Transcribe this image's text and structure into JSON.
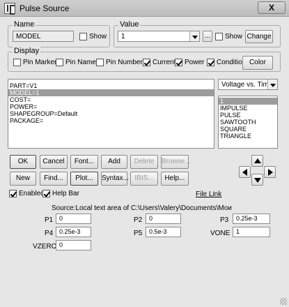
{
  "window": {
    "title": "Pulse Source",
    "close_label": "X"
  },
  "name_group": {
    "label": "Name",
    "value": "MODEL",
    "show_label": "Show",
    "show_checked": false
  },
  "value_group": {
    "label": "Value",
    "value": "1",
    "ellipsis_label": "...",
    "show_label": "Show",
    "show_checked": false,
    "change_label": "Change"
  },
  "display_group": {
    "label": "Display",
    "pin_markers": {
      "label": "Pin Markers",
      "checked": false
    },
    "pin_names": {
      "label": "Pin Names",
      "checked": false
    },
    "pin_numbers": {
      "label": "Pin Numbers",
      "checked": false
    },
    "current": {
      "label": "Current",
      "checked": true
    },
    "power": {
      "label": "Power",
      "checked": true
    },
    "condition": {
      "label": "Condition",
      "checked": true
    },
    "color_label": "Color"
  },
  "attributes": [
    "PART=V1",
    "MODEL=1",
    "COST=",
    "POWER=",
    "SHAPEGROUP=Default",
    "PACKAGE="
  ],
  "selected_attribute_index": 1,
  "plot_type": {
    "value": "Voltage vs. Time"
  },
  "models": [
    "1",
    "IMPULSE",
    "PULSE",
    "SAWTOOTH",
    "SQUARE",
    "TRIANGLE"
  ],
  "selected_model_index": 0,
  "buttons_row1": {
    "ok": "OK",
    "cancel": "Cancel",
    "font": "Font...",
    "add": "Add",
    "delete": "Delete",
    "browse": "Browse..."
  },
  "buttons_row2": {
    "new": "New",
    "find": "Find...",
    "plot": "Plot...",
    "syntax": "Syntax...",
    "ibis": "IBIS...",
    "help": "Help..."
  },
  "options": {
    "enabled": {
      "label": "Enabled",
      "checked": true
    },
    "help_bar": {
      "label": "Help Bar",
      "checked": true
    },
    "file_link": "File Link"
  },
  "source_text": "Source:Local text area of C:\\Users\\Valery\\Documents\\Mои",
  "params": {
    "p1": {
      "label": "P1",
      "value": "0"
    },
    "p2": {
      "label": "P2",
      "value": "0"
    },
    "p3": {
      "label": "P3",
      "value": "0.25e-3"
    },
    "p4": {
      "label": "P4",
      "value": "0.25e-3"
    },
    "p5": {
      "label": "P5",
      "value": "0.5e-3"
    },
    "vone": {
      "label": "VONE",
      "value": "1"
    },
    "vzero": {
      "label": "VZERO",
      "value": "0"
    }
  }
}
